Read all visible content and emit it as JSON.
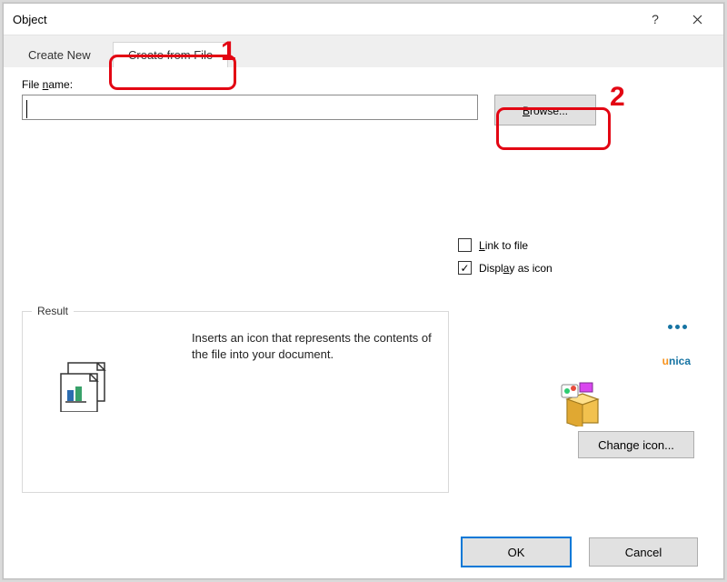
{
  "title": "Object",
  "tabs": {
    "createNew": "Create New",
    "createFromFile": "Create from File"
  },
  "fileLabel": {
    "pre": "File ",
    "u": "n",
    "post": "ame:"
  },
  "fileValue": "",
  "browse": {
    "u": "B",
    "post": "rowse..."
  },
  "linkToFile": {
    "u": "L",
    "post": "ink to file"
  },
  "displayAsIcon": {
    "pre": "Displ",
    "u": "a",
    "post": "y as icon"
  },
  "resultTitle": "Result",
  "resultText": "Inserts an icon that represents the contents of the file into your document.",
  "brand": {
    "u": "u",
    "rest": "nica"
  },
  "changeIcon": "Change icon...",
  "ok": "OK",
  "cancel": "Cancel",
  "annotations": {
    "one": "1",
    "two": "2"
  }
}
